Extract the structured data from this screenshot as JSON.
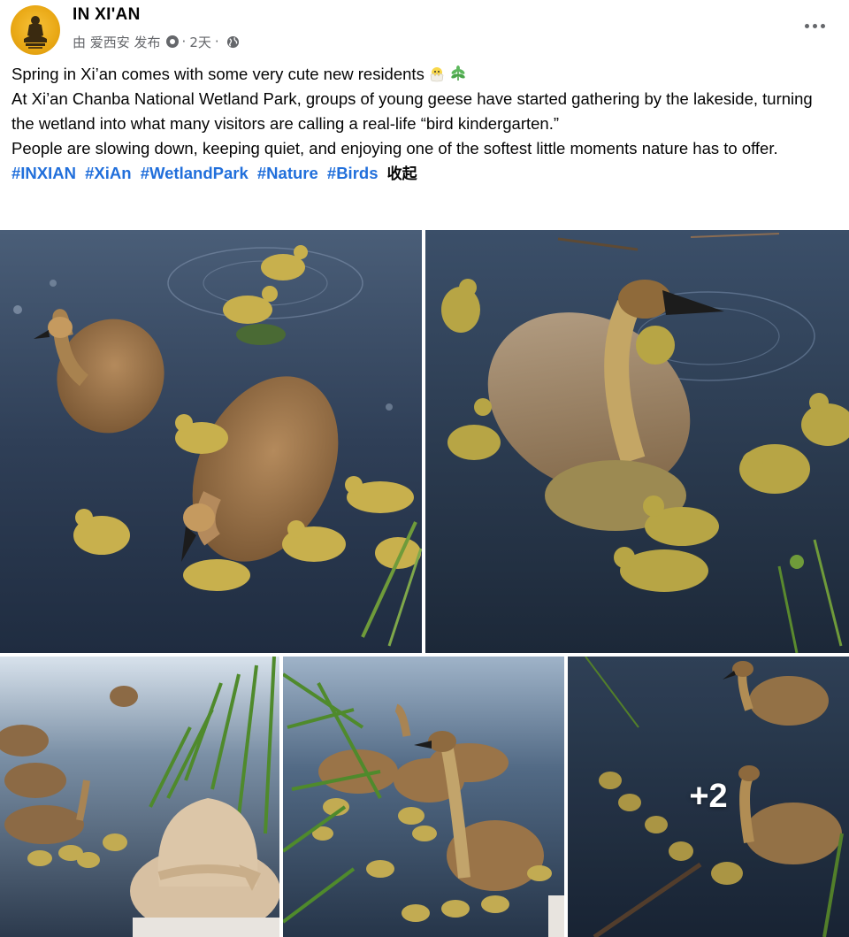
{
  "post": {
    "page_name": "IN XI'AN",
    "meta": {
      "posted_by": "由 爱西安 发布",
      "time": "2天"
    },
    "text_lines": [
      "Spring in Xi’an comes with some very cute new residents",
      "At Xi’an Chanba National Wetland Park, groups of young geese have started gathering by the lakeside, turning the wetland into what many visitors are calling a real-life “bird kindergarten.”",
      "People are slowing down, keeping quiet, and enjoying one of the softest little moments nature has to offer."
    ],
    "hashtags": [
      "#INXIAN",
      "#XiAn",
      "#WetlandPark",
      "#Nature",
      "#Birds"
    ],
    "collapse_label": "收起",
    "emojis": [
      "hatching-chick-icon",
      "herb-icon"
    ],
    "photos": {
      "count_shown": 5,
      "more_label": "+2"
    }
  },
  "colors": {
    "hashtag": "#216fdb",
    "meta_text": "#65676b",
    "avatar": "#e9a815"
  }
}
